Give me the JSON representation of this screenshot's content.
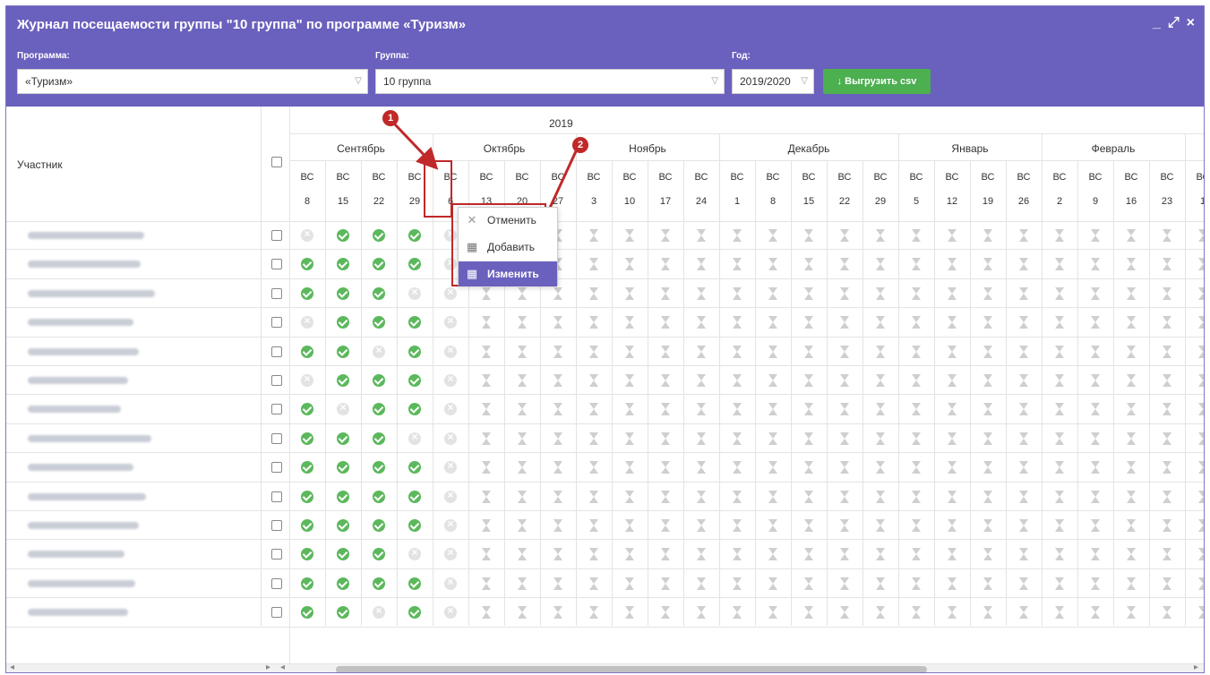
{
  "window": {
    "title": "Журнал посещаемости группы \"10 группа\" по программе «Туризм»",
    "controls": [
      "_",
      "⤢",
      "×"
    ]
  },
  "filters": {
    "program": {
      "label": "Программа:",
      "value": "«Туризм»"
    },
    "group": {
      "label": "Группа:",
      "value": "10 группа"
    },
    "year": {
      "label": "Год:",
      "value": "2019/2020"
    },
    "export_button": "Выгрузить csv"
  },
  "table": {
    "participant_header": "Участник",
    "year": "2019",
    "months": [
      "Сентябрь",
      "Октябрь",
      "Ноябрь",
      "Декабрь",
      "Январь",
      "Февраль"
    ],
    "month_spans": [
      4,
      4,
      4,
      5,
      4,
      4
    ],
    "dow": "ВС",
    "days": [
      "8",
      "15",
      "22",
      "29",
      "6",
      "13",
      "20",
      "27",
      "3",
      "10",
      "17",
      "24",
      "1",
      "8",
      "15",
      "22",
      "29",
      "5",
      "12",
      "19",
      "26",
      "2",
      "9",
      "16",
      "23",
      "1"
    ],
    "rows": [
      [
        "x",
        "v",
        "v",
        "v",
        "x"
      ],
      [
        "v",
        "v",
        "v",
        "v",
        "x"
      ],
      [
        "v",
        "v",
        "v",
        "x",
        "x"
      ],
      [
        "x",
        "v",
        "v",
        "v",
        "x"
      ],
      [
        "v",
        "v",
        "x",
        "v",
        "x"
      ],
      [
        "x",
        "v",
        "v",
        "v",
        "x"
      ],
      [
        "v",
        "x",
        "v",
        "v",
        "x"
      ],
      [
        "v",
        "v",
        "v",
        "x",
        "x"
      ],
      [
        "v",
        "v",
        "v",
        "v",
        "x"
      ],
      [
        "v",
        "v",
        "v",
        "v",
        "x"
      ],
      [
        "v",
        "v",
        "v",
        "v",
        "x"
      ],
      [
        "v",
        "v",
        "v",
        "x",
        "x"
      ],
      [
        "v",
        "v",
        "v",
        "v",
        "x"
      ],
      [
        "v",
        "v",
        "x",
        "v",
        "x"
      ]
    ]
  },
  "context_menu": {
    "items": [
      {
        "label": "Отменить",
        "icon": "close-icon"
      },
      {
        "label": "Добавить",
        "icon": "calendar-add-icon"
      },
      {
        "label": "Изменить",
        "icon": "calendar-edit-icon",
        "selected": true
      }
    ]
  },
  "annotations": [
    "1",
    "2"
  ],
  "colors": {
    "header": "#6a60bd",
    "present": "#5cb85c",
    "absent": "#e3e3e3",
    "annotation": "#c0282a",
    "export": "#4caf50"
  }
}
